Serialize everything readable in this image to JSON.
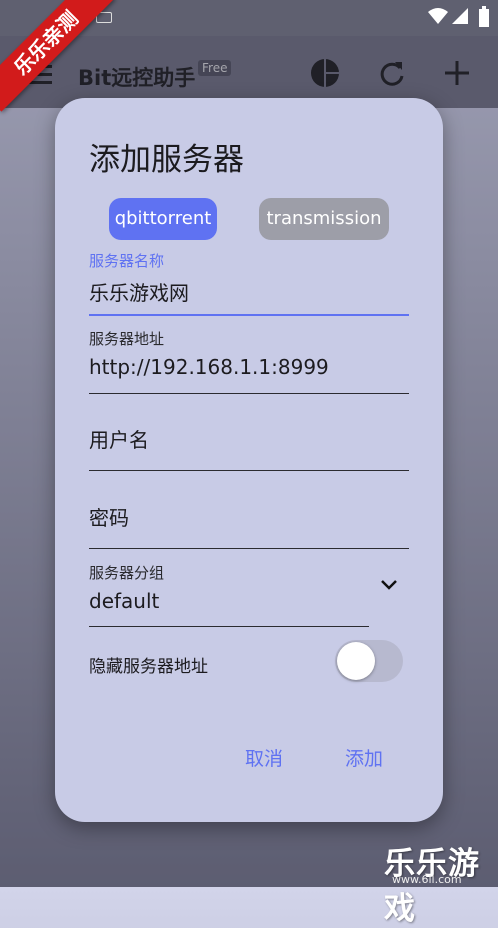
{
  "statusbar": {
    "ribbon_text": "乐乐亲测"
  },
  "appbar": {
    "title": "Bit远控助手",
    "badge": "Free"
  },
  "dialog": {
    "title": "添加服务器",
    "chips": [
      "qbittorrent",
      "transmission"
    ],
    "server_name": {
      "label": "服务器名称",
      "value": "乐乐游戏网"
    },
    "server_address": {
      "label": "服务器地址",
      "value": "http://192.168.1.1:8999"
    },
    "username": {
      "placeholder": "用户名"
    },
    "password": {
      "placeholder": "密码"
    },
    "server_group": {
      "label": "服务器分组",
      "value": "default"
    },
    "hide_address": {
      "label": "隐藏服务器地址",
      "on": false
    },
    "actions": {
      "cancel": "取消",
      "add": "添加"
    }
  },
  "watermark": {
    "text": "乐乐游戏",
    "url": "www.6ll.com"
  },
  "colors": {
    "accent": "#5f72f2",
    "dialog_bg": "#c8cbe6",
    "chip_inactive": "#9d9ea8"
  },
  "icons": [
    "menu-icon",
    "pie-chart-icon",
    "refresh-icon",
    "add-icon",
    "wifi-icon",
    "signal-icon",
    "battery-icon",
    "chevron-down-icon"
  ]
}
